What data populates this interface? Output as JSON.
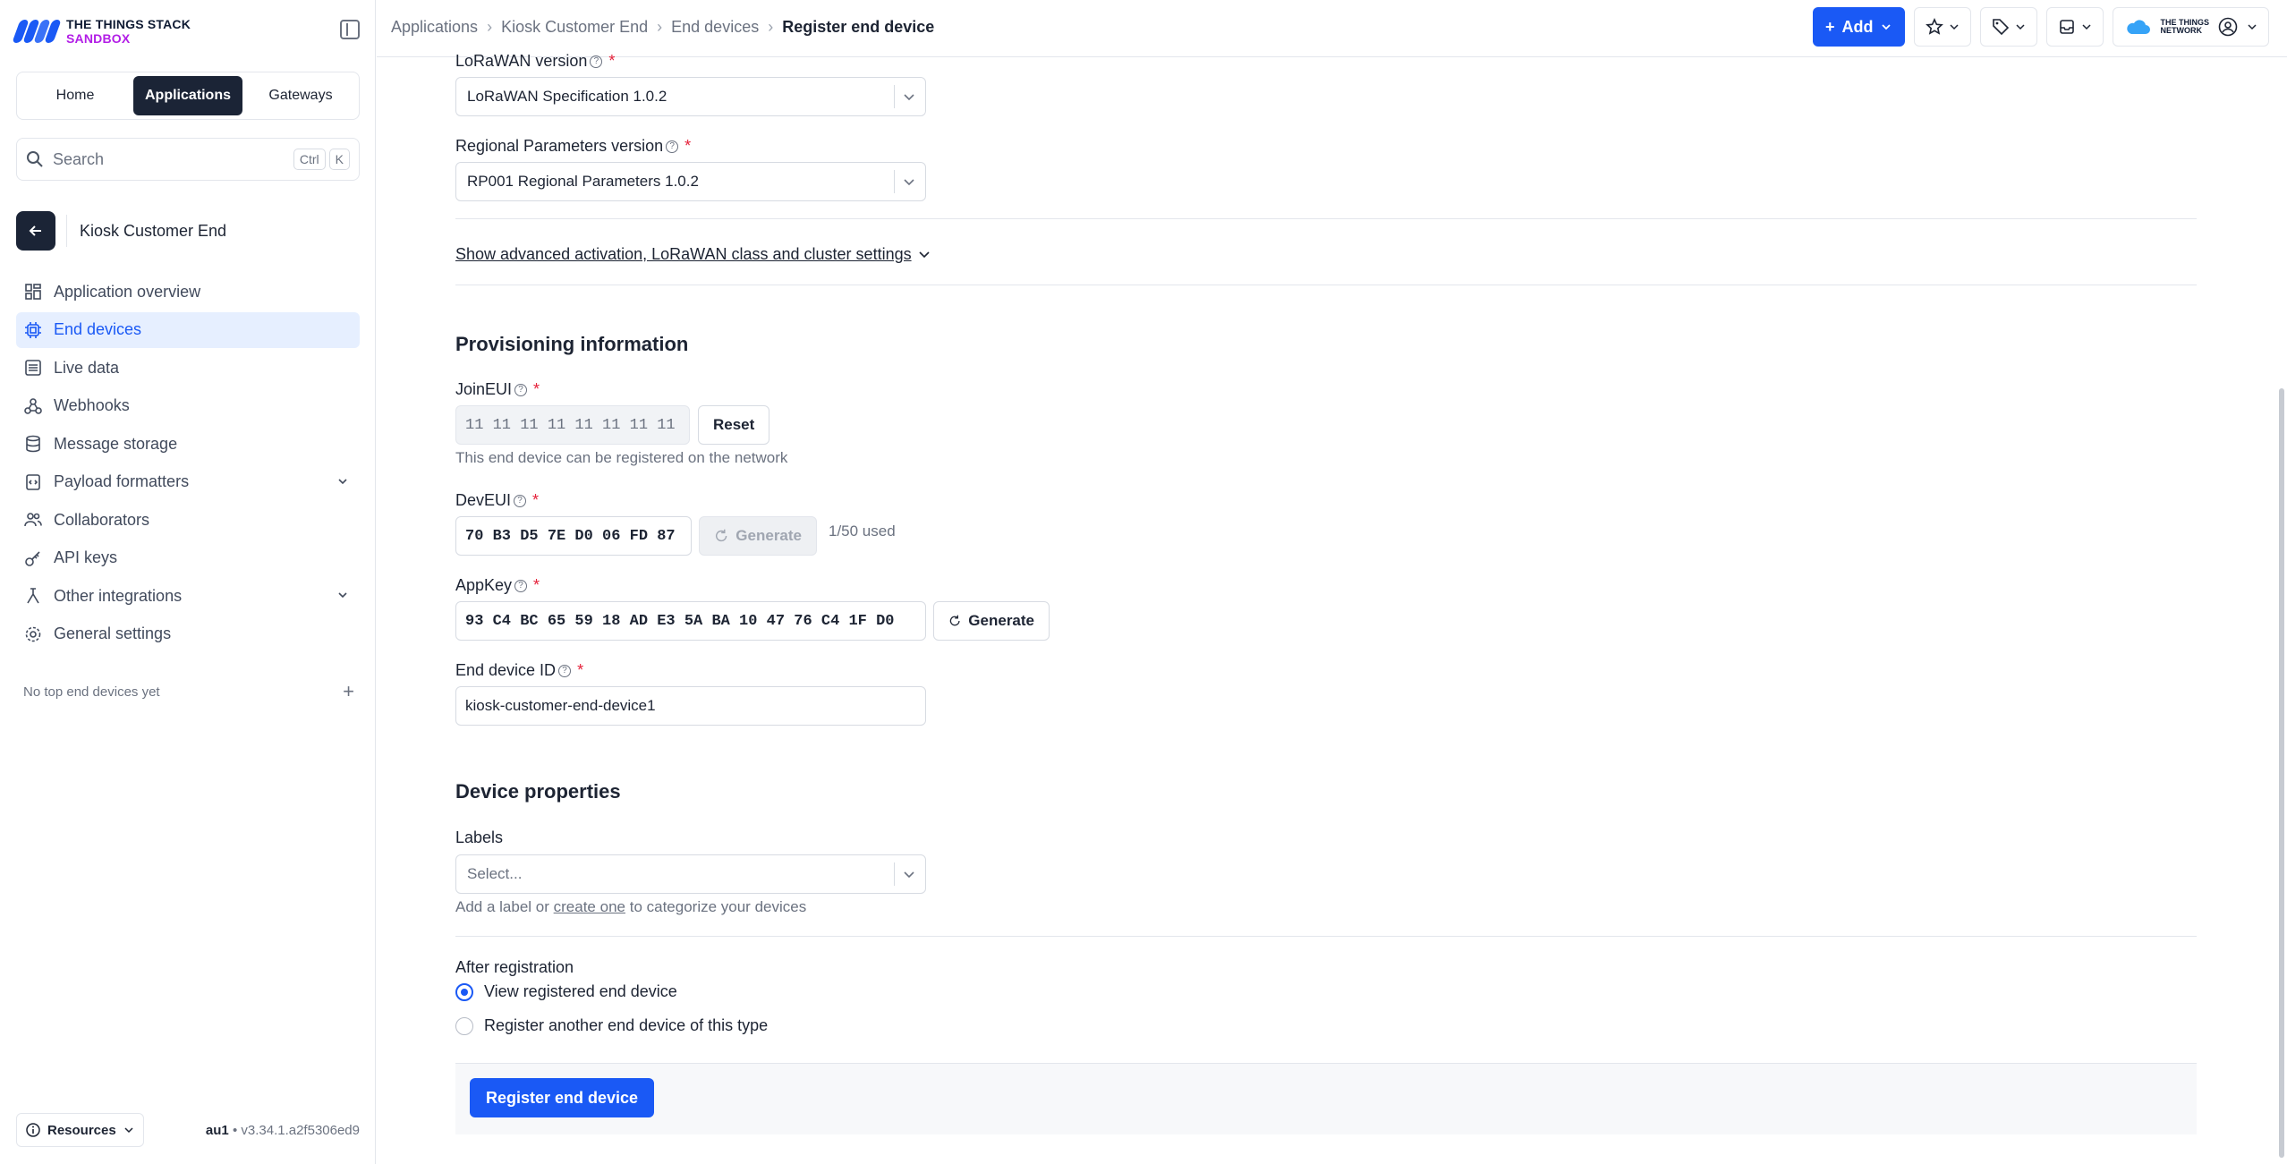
{
  "brand": {
    "line1": "THE THINGS STACK",
    "line2": "SANDBOX"
  },
  "nav_tabs": [
    "Home",
    "Applications",
    "Gateways"
  ],
  "search": {
    "placeholder": "Search",
    "key1": "Ctrl",
    "key2": "K"
  },
  "app": {
    "name": "Kiosk Customer End"
  },
  "sidebar": {
    "items": [
      {
        "label": "Application overview",
        "icon": "grid-icon"
      },
      {
        "label": "End devices",
        "icon": "chip-icon",
        "active": true
      },
      {
        "label": "Live data",
        "icon": "list-icon"
      },
      {
        "label": "Webhooks",
        "icon": "webhook-icon"
      },
      {
        "label": "Message storage",
        "icon": "database-icon"
      },
      {
        "label": "Payload formatters",
        "icon": "code-icon",
        "expandable": true
      },
      {
        "label": "Collaborators",
        "icon": "users-icon"
      },
      {
        "label": "API keys",
        "icon": "key-icon"
      },
      {
        "label": "Other integrations",
        "icon": "integration-icon",
        "expandable": true
      },
      {
        "label": "General settings",
        "icon": "gear-icon"
      }
    ],
    "top_devices_empty": "No top end devices yet",
    "resources": "Resources",
    "cluster": "au1",
    "version": "v3.34.1.a2f5306ed9"
  },
  "breadcrumb": [
    "Applications",
    "Kiosk Customer End",
    "End devices",
    "Register end device"
  ],
  "topbar": {
    "add_label": "Add",
    "ttn_line1": "THE THINGS",
    "ttn_line2": "NETWORK"
  },
  "form": {
    "lorawan_label": "LoRaWAN version",
    "lorawan_value": "LoRaWAN Specification 1.0.2",
    "regional_label": "Regional Parameters version",
    "regional_value": "RP001 Regional Parameters 1.0.2",
    "advanced_link": "Show advanced activation, LoRaWAN class and cluster settings",
    "provisioning_title": "Provisioning information",
    "joineui_label": "JoinEUI",
    "joineui_value": "11 11 11 11 11 11 11 11",
    "reset_label": "Reset",
    "joineui_hint": "This end device can be registered on the network",
    "deveui_label": "DevEUI",
    "deveui_value": "70 B3 D5 7E D0 06 FD 87",
    "generate_label": "Generate",
    "deveui_usage": "1/50 used",
    "appkey_label": "AppKey",
    "appkey_value": "93 C4 BC 65 59 18 AD E3 5A BA 10 47 76 C4 1F D0",
    "device_id_label": "End device ID",
    "device_id_value": "kiosk-customer-end-device1",
    "device_props_title": "Device properties",
    "labels_label": "Labels",
    "labels_placeholder": "Select...",
    "labels_hint_pre": "Add a label or",
    "labels_hint_link": "create one",
    "labels_hint_post": "to categorize your devices",
    "after_reg_label": "After registration",
    "radio_view": "View registered end device",
    "radio_another": "Register another end device of this type",
    "submit_label": "Register end device"
  },
  "colors": {
    "primary": "#1a59f5",
    "active_bg": "#e6efff",
    "dark": "#1b2436",
    "required": "#e5213a"
  }
}
